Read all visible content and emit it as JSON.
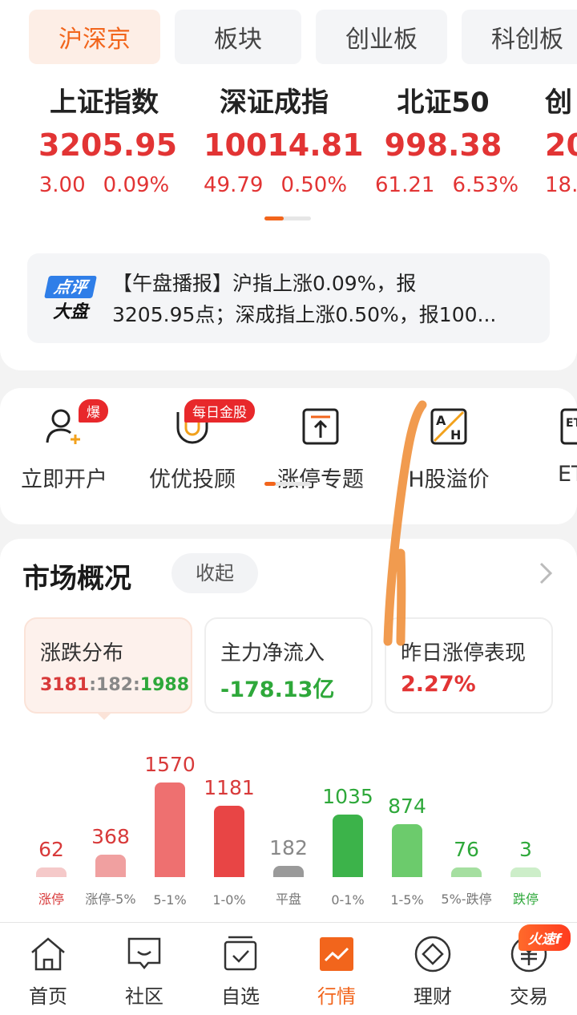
{
  "market_tabs": [
    "沪深京",
    "板块",
    "创业板",
    "科创板"
  ],
  "indices": [
    {
      "name": "上证指数",
      "value": "3205.95",
      "change": "3.00",
      "percent": "0.09%"
    },
    {
      "name": "深证成指",
      "value": "10014.81",
      "change": "49.79",
      "percent": "0.50%"
    },
    {
      "name": "北证50",
      "value": "998.38",
      "change": "61.21",
      "percent": "6.53%"
    },
    {
      "name": "创",
      "value": "20",
      "change": "18.",
      "percent": ""
    }
  ],
  "news": {
    "badge_top": "点评",
    "badge_bottom": "大盘",
    "line1": "【午盘播报】沪指上涨0.09%，报",
    "line2": "3205.95点；深成指上涨0.50%，报100..."
  },
  "shortcuts": [
    {
      "label": "立即开户",
      "badge": "爆",
      "icon": "add-user-icon"
    },
    {
      "label": "优优投顾",
      "badge": "每日金股",
      "icon": "magnet-icon"
    },
    {
      "label": "涨停专题",
      "badge": "",
      "icon": "limit-up-icon"
    },
    {
      "label": "H股溢价",
      "badge": "",
      "icon": "ah-premium-icon"
    },
    {
      "label": "ET",
      "badge": "",
      "icon": "etf-icon"
    }
  ],
  "market_overview": {
    "title": "市场概况",
    "collapse_label": "收起",
    "stats": [
      {
        "title": "涨跌分布",
        "up": "3181",
        "sep1": ":",
        "flat": "182",
        "sep2": ":",
        "down": "1988"
      },
      {
        "title": "主力净流入",
        "value": "-178.13亿"
      },
      {
        "title": "昨日涨停表现",
        "value": "2.27%"
      }
    ]
  },
  "chart_data": {
    "type": "bar",
    "categories": [
      "涨停",
      "涨停-5%",
      "5-1%",
      "1-0%",
      "平盘",
      "0-1%",
      "1-5%",
      "5%-跌停",
      "跌停"
    ],
    "values": [
      62,
      368,
      1570,
      1181,
      182,
      1035,
      874,
      76,
      3
    ],
    "colors": [
      "#f5c9c9",
      "#f0a0a0",
      "#ee7070",
      "#e84545",
      "#9a9a9a",
      "#3cb34a",
      "#6ccb6c",
      "#a5dfa0",
      "#cdeec9"
    ],
    "label_colors": [
      "#d83a3a",
      "#d83a3a",
      "#d83a3a",
      "#d83a3a",
      "#888888",
      "#2ea83a",
      "#2ea83a",
      "#2ea83a",
      "#2ea83a"
    ]
  },
  "bottom_nav": [
    {
      "label": "首页",
      "icon": "home-icon"
    },
    {
      "label": "社区",
      "icon": "community-icon"
    },
    {
      "label": "自选",
      "icon": "watchlist-icon"
    },
    {
      "label": "行情",
      "icon": "market-icon"
    },
    {
      "label": "理财",
      "icon": "wealth-icon"
    },
    {
      "label": "交易",
      "icon": "trade-icon"
    }
  ],
  "hot_badge": "火速f",
  "colors": {
    "accent": "#f2651c",
    "up": "#e23434",
    "down": "#2ea83a"
  }
}
